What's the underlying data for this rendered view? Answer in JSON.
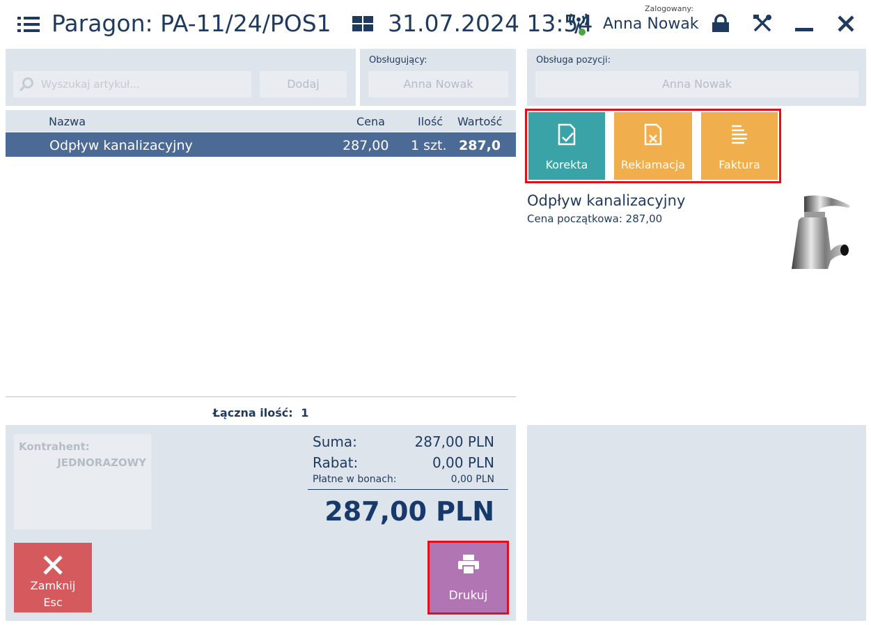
{
  "header": {
    "title": "Paragon: PA-11/24/POS1",
    "datetime": "31.07.2024 13:54",
    "logged_caption": "Zalogowany:",
    "user": "Anna Nowak"
  },
  "search": {
    "placeholder": "Wyszukaj artykuł...",
    "add_label": "Dodaj"
  },
  "serving": {
    "label": "Obsługujący:",
    "value": "Anna Nowak"
  },
  "item_service": {
    "label": "Obsługa pozycji:",
    "value": "Anna Nowak"
  },
  "table": {
    "columns": {
      "name": "Nazwa",
      "price": "Cena",
      "qty": "Ilość",
      "value": "Wartość"
    },
    "rows": [
      {
        "name": "Odpływ kanalizacyjny",
        "price": "287,00",
        "qty": "1 szt.",
        "value": "287,00"
      }
    ],
    "total_qty_label": "Łączna ilość:",
    "total_qty": "1"
  },
  "actions": {
    "korekta": "Korekta",
    "reklamacja": "Reklamacja",
    "faktura": "Faktura"
  },
  "detail": {
    "name": "Odpływ kanalizacyjny",
    "price_line": "Cena początkowa: 287,00"
  },
  "customer": {
    "label": "Kontrahent:",
    "value": "JEDNORAZOWY"
  },
  "summary": {
    "sum_label": "Suma:",
    "sum_value": "287,00 PLN",
    "discount_label": "Rabat:",
    "discount_value": "0,00 PLN",
    "vouchers_label": "Płatne w bonach:",
    "vouchers_value": "0,00 PLN",
    "total": "287,00 PLN"
  },
  "buttons": {
    "close_label": "Zamknij",
    "close_key": "Esc",
    "print_label": "Drukuj"
  },
  "colors": {
    "korekta": "#3aa3a8",
    "reklamacja": "#f0ae4c",
    "faktura": "#f0ae4c",
    "close": "#d55a5e",
    "print": "#b275b3",
    "selected_row": "#4b6b96"
  }
}
